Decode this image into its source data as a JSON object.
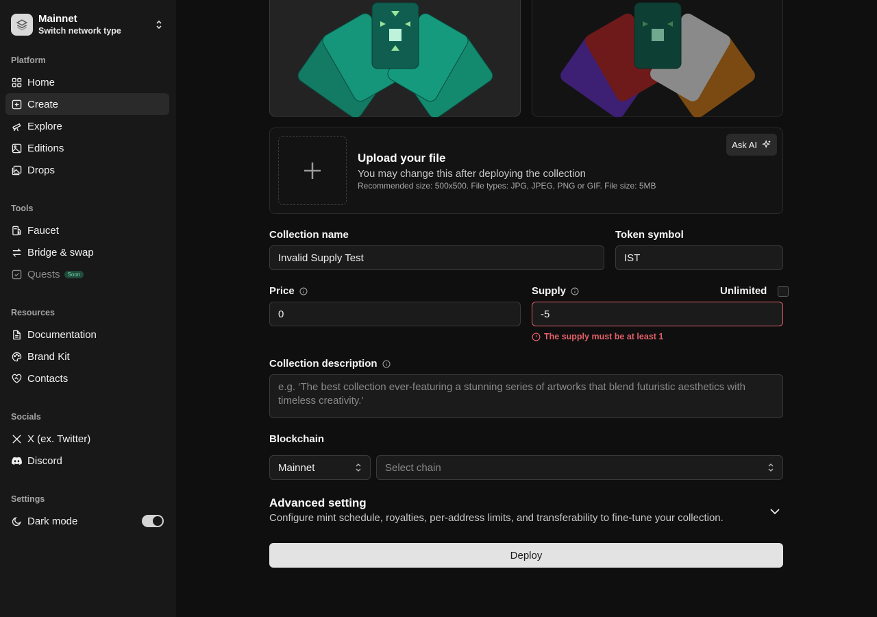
{
  "network": {
    "title": "Mainnet",
    "subtitle": "Switch network type"
  },
  "sidebar": {
    "platform": {
      "heading": "Platform",
      "items": [
        "Home",
        "Create",
        "Explore",
        "Editions",
        "Drops"
      ]
    },
    "tools": {
      "heading": "Tools",
      "items": [
        "Faucet",
        "Bridge & swap",
        "Quests"
      ],
      "soon_badge": "Soon"
    },
    "resources": {
      "heading": "Resources",
      "items": [
        "Documentation",
        "Brand Kit",
        "Contacts"
      ]
    },
    "socials": {
      "heading": "Socials",
      "items": [
        "X (ex. Twitter)",
        "Discord"
      ]
    },
    "settings": {
      "heading": "Settings",
      "dark_mode_label": "Dark mode",
      "dark_mode_on": true
    }
  },
  "artwork": {
    "left_label": "artwork",
    "right_label": "artwork"
  },
  "upload": {
    "title": "Upload your file",
    "subtitle": "You may change this after deploying the collection",
    "hint": "Recommended size: 500x500. File types: JPG, JPEG, PNG or GIF. File size: 5MB",
    "ask_ai": "Ask AI"
  },
  "form": {
    "collection_name_label": "Collection name",
    "collection_name_value": "Invalid Supply Test",
    "token_symbol_label": "Token symbol",
    "token_symbol_value": "IST",
    "price_label": "Price",
    "price_value": "0",
    "supply_label": "Supply",
    "supply_value": "-5",
    "unlimited_label": "Unlimited",
    "supply_error": "The supply must be at least 1",
    "description_label": "Collection description",
    "description_placeholder": "e.g. ‘The best collection ever-featuring a stunning series of artworks that blend futuristic aesthetics with timeless creativity.’",
    "blockchain_label": "Blockchain",
    "network_select": "Mainnet",
    "chain_placeholder": "Select chain",
    "advanced_title": "Advanced setting",
    "advanced_desc": "Configure mint schedule, royalties, per-address limits, and transferability to fine-tune your collection.",
    "deploy_label": "Deploy"
  },
  "colors": {
    "error": "#e3606a",
    "accent_green": "#1fae8c",
    "soon_badge": "#1f4a3c"
  }
}
